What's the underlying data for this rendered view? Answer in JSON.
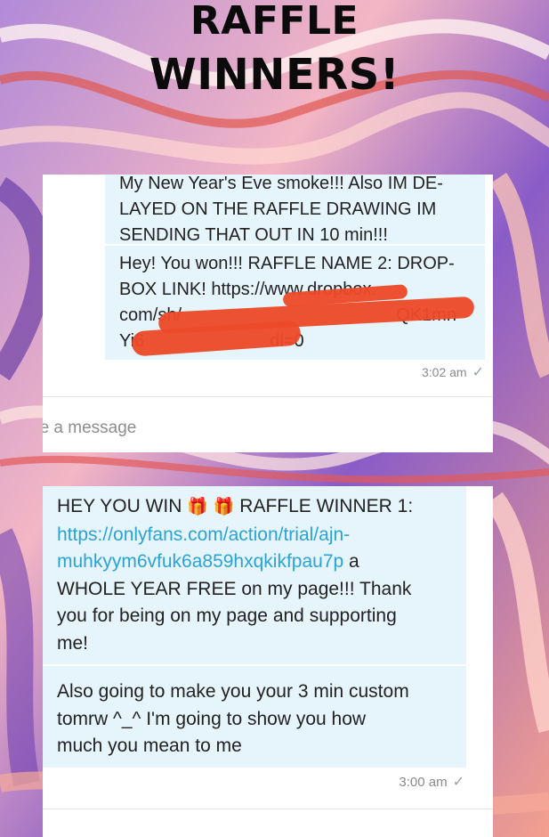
{
  "title": {
    "line1": "RAFFLE",
    "line2": "WINNERS!"
  },
  "screenshot1": {
    "msg1_line1": "My New Year's Eve smoke!!! Also IM DE-",
    "msg1_line2": "LAYED ON THE RAFFLE DRAWING IM",
    "msg1_line3": "SENDING THAT OUT IN 10 min!!!",
    "msg2_line1": "Hey! You won!!! RAFFLE NAME 2: DROP-",
    "msg2_line2": "BOX LINK! https://www.dropbox.",
    "msg2_line3": "com/sh/",
    "msg2_line3_tail": "QK1mn",
    "msg2_line4": "Yi6",
    "msg2_line4_tail": "dl=0",
    "time": "3:02 am",
    "composer_placeholder": "pe a message"
  },
  "screenshot2": {
    "msg1_part1": "HEY YOU WIN",
    "msg1_part2": "RAFFLE WINNER 1:",
    "msg1_link_line1": "https://onlyfans.com/action/trial/ajn-",
    "msg1_link_line2": "muhkyym6vfuk6a859hxqkikfpau7p",
    "msg1_after_link": " a",
    "msg1_rest_line1": "WHOLE YEAR FREE on my page!!! Thank",
    "msg1_rest_line2": "you for being on my page and supporting",
    "msg1_rest_line3": "me!",
    "msg2_line1": "Also going to make you your 3 min custom",
    "msg2_line2": "tomrw ^_^ I'm going to show you how",
    "msg2_line3": "much you mean to me",
    "time": "3:00 am"
  },
  "icons": {
    "gift": "gift-icon",
    "read_receipt": "checkmark-icon"
  },
  "colors": {
    "bubble": "#e6f4fb",
    "link": "#2aa3d8",
    "redaction": "#ec4a2a"
  }
}
